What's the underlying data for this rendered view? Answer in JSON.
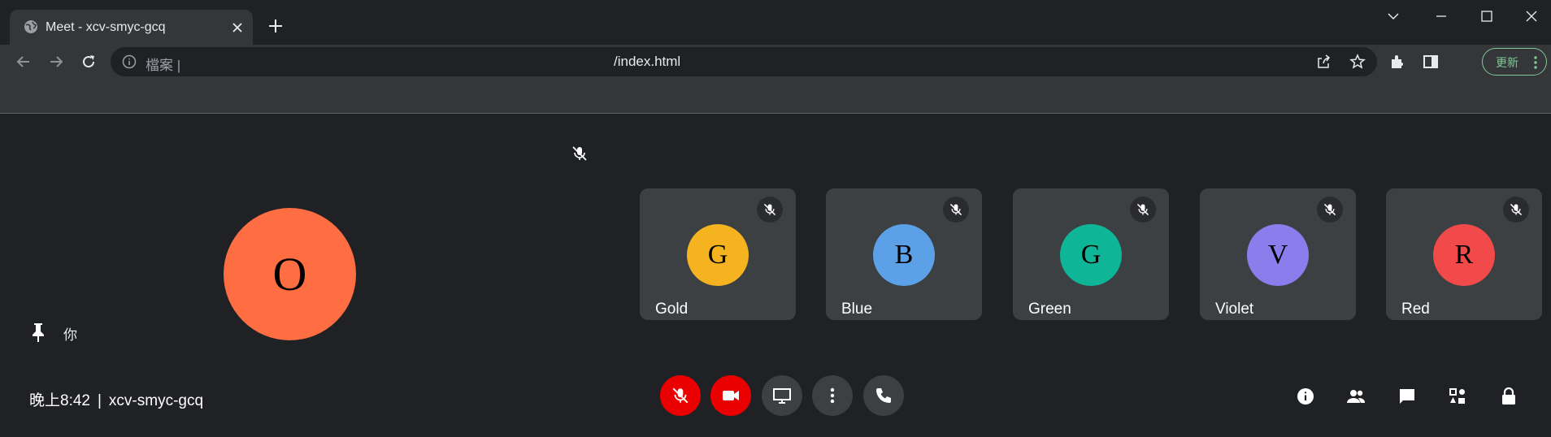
{
  "browser": {
    "tab_title": "Meet - xcv-smyc-gcq",
    "scheme_label": "檔案 |",
    "url": "/index.html",
    "update_label": "更新"
  },
  "self": {
    "avatar_letter": "O",
    "avatar_color": "#ff6d43",
    "name_label": "你"
  },
  "participants": [
    {
      "name": "Gold",
      "letter": "G",
      "color": "#f4b31f"
    },
    {
      "name": "Blue",
      "letter": "B",
      "color": "#5ca1e8"
    },
    {
      "name": "Green",
      "letter": "G",
      "color": "#0fb597"
    },
    {
      "name": "Violet",
      "letter": "V",
      "color": "#8c7ded"
    },
    {
      "name": "Red",
      "letter": "R",
      "color": "#f24a4a"
    }
  ],
  "meeting": {
    "time": "晚上8:42",
    "separator": "|",
    "code": "xcv-smyc-gcq"
  },
  "controls": [
    {
      "icon": "mic-off-icon",
      "state": "muted",
      "color": "#ea0000"
    },
    {
      "icon": "camera-icon",
      "state": "active",
      "color": "#ea0000"
    },
    {
      "icon": "present-screen-icon",
      "color": "#3c4043"
    },
    {
      "icon": "more-options-icon",
      "color": "#3c4043"
    },
    {
      "icon": "leave-call-icon",
      "color": "#3c4043"
    }
  ],
  "side_panel_icons": [
    "info-icon",
    "people-icon",
    "chat-icon",
    "activities-icon",
    "host-controls-lock-icon"
  ]
}
